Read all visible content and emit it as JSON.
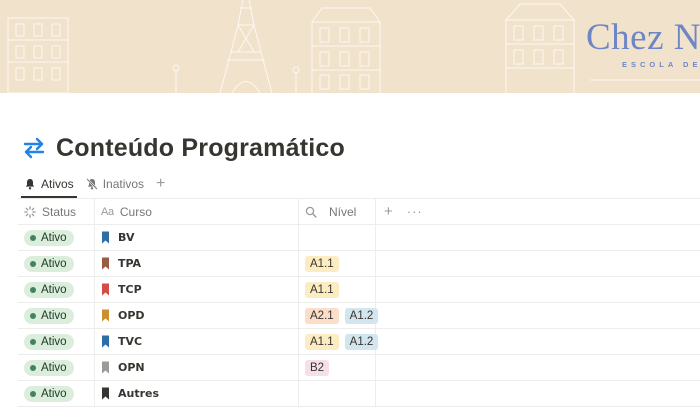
{
  "cover": {
    "brand": "Chez N",
    "brand_sub": "ESCOLA DE F"
  },
  "page": {
    "icon": "arrows-left-right-icon",
    "title": "Conteúdo Programático"
  },
  "tabs": [
    {
      "label": "Ativos",
      "icon": "bell-icon",
      "active": true
    },
    {
      "label": "Inativos",
      "icon": "bell-off-icon",
      "active": false
    }
  ],
  "columns": {
    "status": "Status",
    "curso_prefix": "Aa",
    "curso": "Curso",
    "nivel": "Nível"
  },
  "colors": {
    "accent": "#2383e2",
    "status_green": "#448361",
    "brand_blue": "#6f86c6"
  },
  "rows": [
    {
      "status": "Ativo",
      "curso": "BV",
      "bookmark_color": "#2e6ea6",
      "niveis": []
    },
    {
      "status": "Ativo",
      "curso": "TPA",
      "bookmark_color": "#9a5b43",
      "niveis": [
        "A1.1"
      ]
    },
    {
      "status": "Ativo",
      "curso": "TCP",
      "bookmark_color": "#d44c47",
      "niveis": [
        "A1.1"
      ]
    },
    {
      "status": "Ativo",
      "curso": "OPD",
      "bookmark_color": "#cb912f",
      "niveis": [
        "A2.1",
        "A1.2"
      ]
    },
    {
      "status": "Ativo",
      "curso": "TVC",
      "bookmark_color": "#2e6ea6",
      "niveis": [
        "A1.1",
        "A1.2"
      ]
    },
    {
      "status": "Ativo",
      "curso": "OPN",
      "bookmark_color": "#9b9a97",
      "niveis": [
        "B2"
      ]
    },
    {
      "status": "Ativo",
      "curso": "Autres",
      "bookmark_color": "#37352f",
      "niveis": []
    }
  ]
}
